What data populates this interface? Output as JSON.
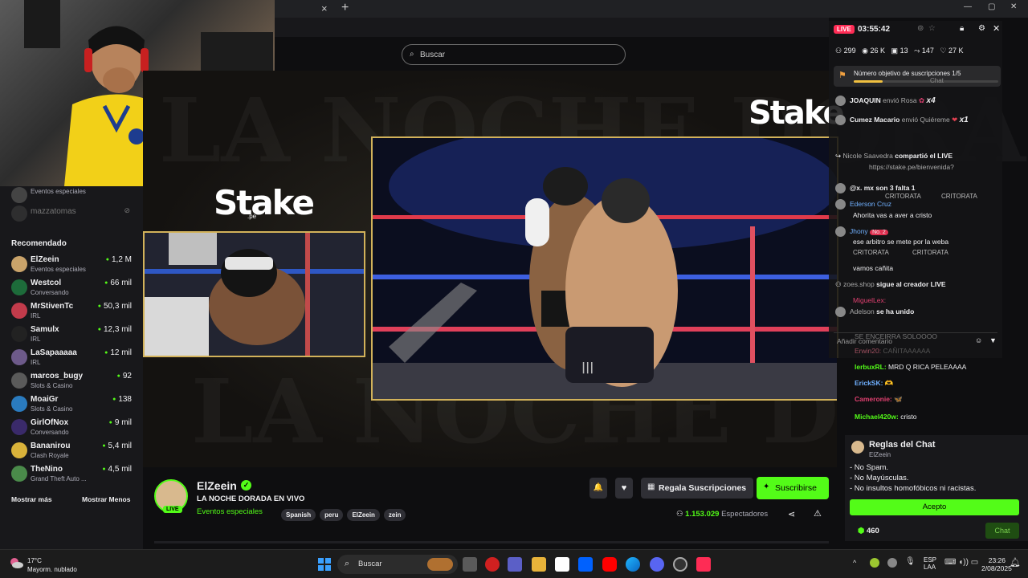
{
  "browser": {
    "tab_close": "×",
    "tab_new": "+",
    "window_controls": [
      "—",
      "▢",
      "✕"
    ]
  },
  "search": {
    "placeholder": "Buscar"
  },
  "sidebar": {
    "top_items": [
      {
        "category": "Eventos especiales"
      },
      {
        "name": "mazzatomas"
      }
    ],
    "section_title": "Recomendado",
    "items": [
      {
        "name": "ElZeein",
        "category": "Eventos especiales",
        "count": "1,2 M"
      },
      {
        "name": "Westcol",
        "category": "Conversando",
        "count": "66 mil"
      },
      {
        "name": "MrStivenTc",
        "category": "IRL",
        "count": "50,3 mil"
      },
      {
        "name": "Samulx",
        "category": "IRL",
        "count": "12,3 mil"
      },
      {
        "name": "LaSapaaaaa",
        "category": "IRL",
        "count": "12 mil"
      },
      {
        "name": "marcos_bugy",
        "category": "Slots & Casino",
        "count": "92"
      },
      {
        "name": "MoaiGr",
        "category": "Slots & Casino",
        "count": "138"
      },
      {
        "name": "GirlOfNox",
        "category": "Conversando",
        "count": "9 mil"
      },
      {
        "name": "Bananirou",
        "category": "Clash Royale",
        "count": "5,4 mil"
      },
      {
        "name": "TheNino",
        "category": "Grand Theft Auto ...",
        "count": "4,5 mil"
      }
    ],
    "show_more": "Mostrar más",
    "show_less": "Mostrar Menos"
  },
  "stage": {
    "logo_big": "Stake",
    "logo_small": "Stake",
    "logo_small_sub": ".pe",
    "bg_text_1": "LA NOCHE DORADA",
    "bg_text_2": "LA NOCHE DORADA"
  },
  "stream": {
    "channel": "ElZeein",
    "title": "LA NOCHE DORADA EN VIVO",
    "category": "Eventos especiales",
    "live_badge": "LIVE",
    "tags": [
      "Spanish",
      "peru",
      "ElZeein",
      "zein"
    ],
    "gift_label": "Regala Suscripciones",
    "subscribe_label": "Suscribirse",
    "viewers": "1.153.029",
    "viewers_label": "Espectadores"
  },
  "overlay_chat": {
    "live": "LIVE",
    "timer": "03:55:42",
    "stats": {
      "users": "299",
      "views": "26 K",
      "gifts": "13",
      "shares": "147",
      "likes": "27 K"
    },
    "goal_text": "Número objetivo de suscripciones",
    "goal_progress": "1/5",
    "goal_fraction": 0.2,
    "ghost_label": "Chat",
    "gift_events": [
      {
        "user": "JOAQUIN",
        "text": "envió Rosa",
        "mult": "x4"
      },
      {
        "user": "Cumez Macario",
        "text": "envió Quiéreme",
        "mult": "x1"
      }
    ],
    "messages": [
      {
        "user": "Nicole Saavedra",
        "text": "compartió el LIVE"
      },
      {
        "user": "",
        "text": "https://stake.pe/bienvenida?"
      },
      {
        "user": "@x. mx son 3 falta 1",
        "text": ""
      },
      {
        "user": "Ederson Cruz",
        "text": ""
      },
      {
        "user": "Ahorita vas a aver a cristo",
        "text": ""
      },
      {
        "user": "Jhony",
        "text": "No. 2"
      },
      {
        "user": "ese arbitro se mete por la weba",
        "text": ""
      },
      {
        "user": "vamos cañita",
        "text": ""
      },
      {
        "user": "zoes.shop",
        "text": "sigue al creador LIVE"
      },
      {
        "user": "MiguelLex:",
        "text": ""
      },
      {
        "user": "Adelson",
        "text": "se ha unido"
      }
    ],
    "spam_word": "CRITORATA",
    "comment_placeholder": "Añadir comentario"
  },
  "right_chat": {
    "messages": [
      {
        "user": "SE ENCEIRRA SOLOOOO",
        "text": ""
      },
      {
        "user": "Erwin20:",
        "text": "CAÑITAAAAAA"
      },
      {
        "user": "lerbuxRL:",
        "text": "MRD Q RICA PELEAAAA"
      },
      {
        "user": "ErickSK:",
        "text": "🫶"
      },
      {
        "user": "Cameronie:",
        "text": "🦋"
      },
      {
        "user": "Michael420w:",
        "text": "cristo"
      }
    ],
    "rules_title": "Reglas del Chat",
    "rules_user": "ElZeein",
    "rules": [
      "- No Spam.",
      "- No Mayúsculas.",
      "- No insultos homofóbicos ni racistas."
    ],
    "accept_label": "Acepto",
    "points": "460",
    "chat_button": "Chat"
  },
  "taskbar": {
    "weather_temp": "17°C",
    "weather_desc": "Mayorm. nublado",
    "search_label": "Buscar",
    "lang": "ESP",
    "lang_sub": "LAA",
    "time": "23:26",
    "date": "2/08/2025"
  }
}
